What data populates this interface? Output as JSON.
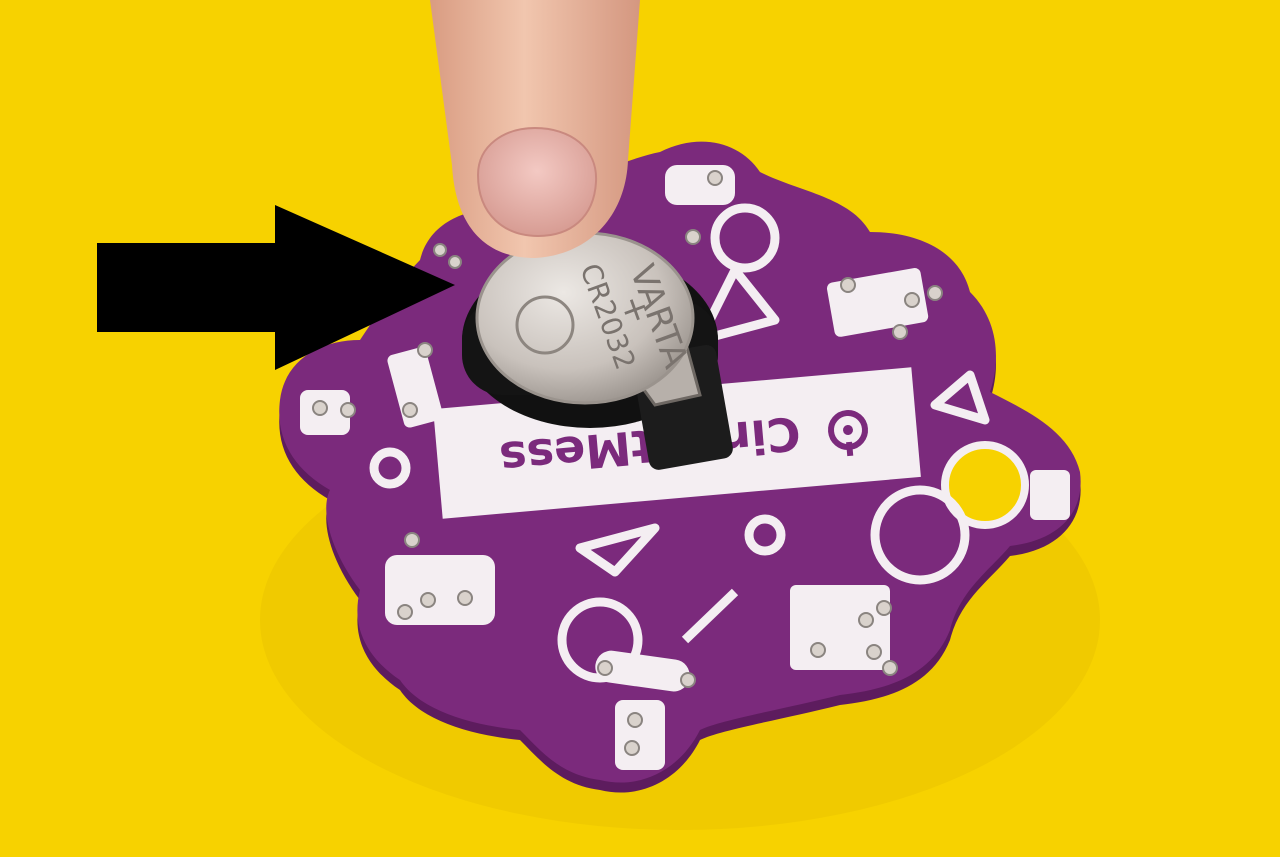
{
  "colors": {
    "background": "#f7d200",
    "board": "#7b2a7c",
    "board_edge": "#5d1c5e",
    "silkscreen": "#f4eef2",
    "arrow": "#000000",
    "battery": "#cfc8c2",
    "holder": "#1a1a1a",
    "finger": "#e9b89e"
  },
  "board": {
    "label_text": "CircuitMess"
  },
  "battery": {
    "brand_text": "VARTA",
    "plus_text": "+",
    "model_text": "CR2032"
  },
  "icons": {
    "arrow": "arrow-right-icon",
    "logo": "circuitmess-logo-icon"
  }
}
